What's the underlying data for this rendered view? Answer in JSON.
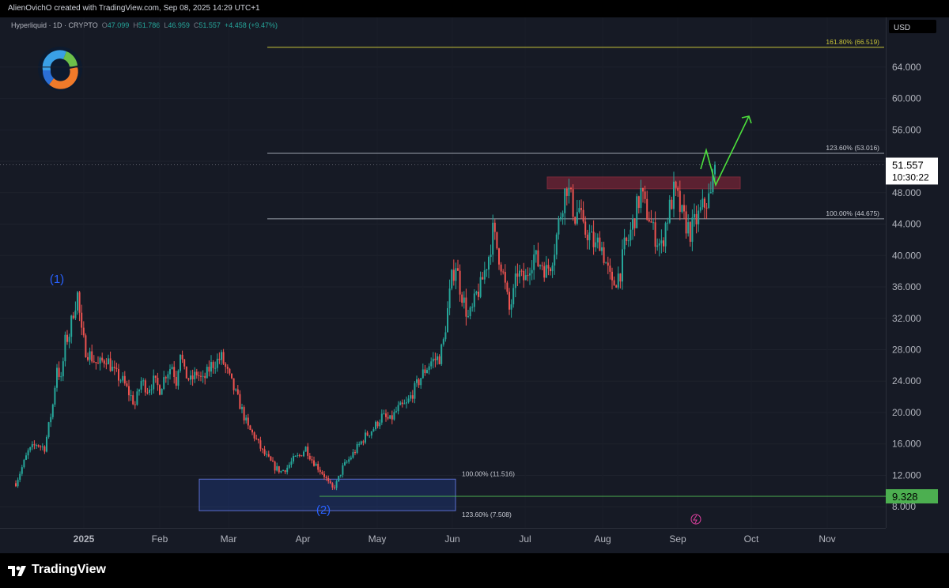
{
  "header": {
    "credit": "AlienOvichO created with TradingView.com, Sep 08, 2025 14:29 UTC+1",
    "symbol": "Hyperliquid · 1D · CRYPTO",
    "o_label": "O",
    "o_value": "47.099",
    "h_label": "H",
    "h_value": "51.786",
    "l_label": "L",
    "l_value": "46.959",
    "c_label": "C",
    "c_value": "51.557",
    "change": "+4.458 (+9.47%)"
  },
  "footer": {
    "brand": "TradingView"
  },
  "colors": {
    "background": "#161a25",
    "up": "#26a69a",
    "down": "#ef5350",
    "fib_top": "#c8c337",
    "projection_arrow": "#4cdf3c",
    "support_line": "#4caf50",
    "wave_label": "#2962ff"
  },
  "chart_data": {
    "type": "candlestick",
    "currency": "USD",
    "y_ticks": [
      "8.000",
      "12.000",
      "16.000",
      "20.000",
      "24.000",
      "28.000",
      "32.000",
      "36.000",
      "40.000",
      "44.000",
      "48.000",
      "52.000",
      "56.000",
      "60.000",
      "64.000"
    ],
    "x_ticks": [
      "2025",
      "Feb",
      "Mar",
      "Apr",
      "May",
      "Jun",
      "Jul",
      "Aug",
      "Sep",
      "Oct",
      "Nov"
    ],
    "ylim": [
      6,
      69
    ],
    "last_price": "51.557",
    "countdown": "10:30:22",
    "support_level": "9.328",
    "fib_levels": [
      {
        "label": "161.80% (66.519)",
        "value": 66.519
      },
      {
        "label": "123.60% (53.016)",
        "value": 53.016
      },
      {
        "label": "100.00% (44.675)",
        "value": 44.675
      },
      {
        "label": "100.00% (11.516)",
        "value": 11.516
      },
      {
        "label": "123.60% (7.508)",
        "value": 7.508
      }
    ],
    "wave_labels": [
      "(1)",
      "(2)"
    ],
    "resistance_zone": [
      48.5,
      50.0
    ],
    "demand_zone": [
      7.5,
      11.516
    ],
    "price_path": [
      [
        0,
        11
      ],
      [
        3,
        13
      ],
      [
        6,
        15
      ],
      [
        10,
        16
      ],
      [
        14,
        15.5
      ],
      [
        18,
        21
      ],
      [
        20,
        26
      ],
      [
        22,
        24
      ],
      [
        24,
        29
      ],
      [
        26,
        30
      ],
      [
        28,
        33
      ],
      [
        30,
        35
      ],
      [
        32,
        30
      ],
      [
        34,
        28
      ],
      [
        37,
        27
      ],
      [
        40,
        26
      ],
      [
        44,
        27
      ],
      [
        48,
        25
      ],
      [
        52,
        24
      ],
      [
        56,
        22
      ],
      [
        58,
        21
      ],
      [
        61,
        24
      ],
      [
        64,
        23
      ],
      [
        67,
        24
      ],
      [
        70,
        23
      ],
      [
        73,
        25
      ],
      [
        76,
        26
      ],
      [
        78,
        24
      ],
      [
        80,
        28
      ],
      [
        82,
        25
      ],
      [
        85,
        24
      ],
      [
        88,
        25
      ],
      [
        91,
        24
      ],
      [
        95,
        26
      ],
      [
        100,
        27
      ],
      [
        103,
        25
      ],
      [
        106,
        23
      ],
      [
        109,
        21
      ],
      [
        113,
        18
      ],
      [
        116,
        17
      ],
      [
        120,
        15
      ],
      [
        123,
        14
      ],
      [
        126,
        13
      ],
      [
        129,
        12.5
      ],
      [
        132,
        13
      ],
      [
        135,
        14
      ],
      [
        138,
        14.5
      ],
      [
        141,
        15.5
      ],
      [
        144,
        14
      ],
      [
        147,
        13
      ],
      [
        150,
        12
      ],
      [
        152,
        11
      ],
      [
        154,
        10.3
      ],
      [
        156,
        11
      ],
      [
        159,
        13
      ],
      [
        162,
        14
      ],
      [
        166,
        15.5
      ],
      [
        170,
        17
      ],
      [
        174,
        18
      ],
      [
        178,
        19.5
      ],
      [
        182,
        19
      ],
      [
        186,
        20.5
      ],
      [
        190,
        21
      ],
      [
        194,
        23
      ],
      [
        198,
        25
      ],
      [
        202,
        26.5
      ],
      [
        206,
        27
      ],
      [
        208,
        29
      ],
      [
        210,
        33
      ],
      [
        212,
        37
      ],
      [
        214,
        39
      ],
      [
        216,
        36
      ],
      [
        218,
        34
      ],
      [
        220,
        32
      ],
      [
        222,
        33
      ],
      [
        224,
        35
      ],
      [
        226,
        36
      ],
      [
        228,
        38
      ],
      [
        230,
        40
      ],
      [
        232,
        43
      ],
      [
        234,
        41
      ],
      [
        236,
        39
      ],
      [
        238,
        36
      ],
      [
        240,
        33
      ],
      [
        242,
        35
      ],
      [
        244,
        38
      ],
      [
        246,
        37
      ],
      [
        248,
        37
      ],
      [
        250,
        39
      ],
      [
        252,
        40
      ],
      [
        254,
        39
      ],
      [
        256,
        39
      ],
      [
        258,
        38
      ],
      [
        260,
        39
      ],
      [
        262,
        41
      ],
      [
        264,
        44
      ],
      [
        266,
        47
      ],
      [
        268,
        49
      ],
      [
        270,
        47
      ],
      [
        272,
        45
      ],
      [
        274,
        46
      ],
      [
        276,
        43
      ],
      [
        278,
        43
      ],
      [
        280,
        42
      ],
      [
        282,
        41
      ],
      [
        284,
        42
      ],
      [
        286,
        40
      ],
      [
        288,
        38
      ],
      [
        290,
        36
      ],
      [
        292,
        37
      ],
      [
        294,
        38
      ],
      [
        296,
        41
      ],
      [
        298,
        42
      ],
      [
        300,
        44
      ],
      [
        302,
        46
      ],
      [
        304,
        48
      ],
      [
        306,
        46
      ],
      [
        308,
        45
      ],
      [
        310,
        43
      ],
      [
        312,
        42
      ],
      [
        314,
        41
      ],
      [
        316,
        44
      ],
      [
        318,
        46
      ],
      [
        320,
        48
      ],
      [
        322,
        47
      ],
      [
        324,
        45
      ],
      [
        326,
        44
      ],
      [
        328,
        43
      ],
      [
        330,
        44
      ],
      [
        332,
        45
      ],
      [
        334,
        46
      ],
      [
        336,
        47
      ],
      [
        338,
        47.5
      ],
      [
        340,
        51.557
      ]
    ]
  }
}
